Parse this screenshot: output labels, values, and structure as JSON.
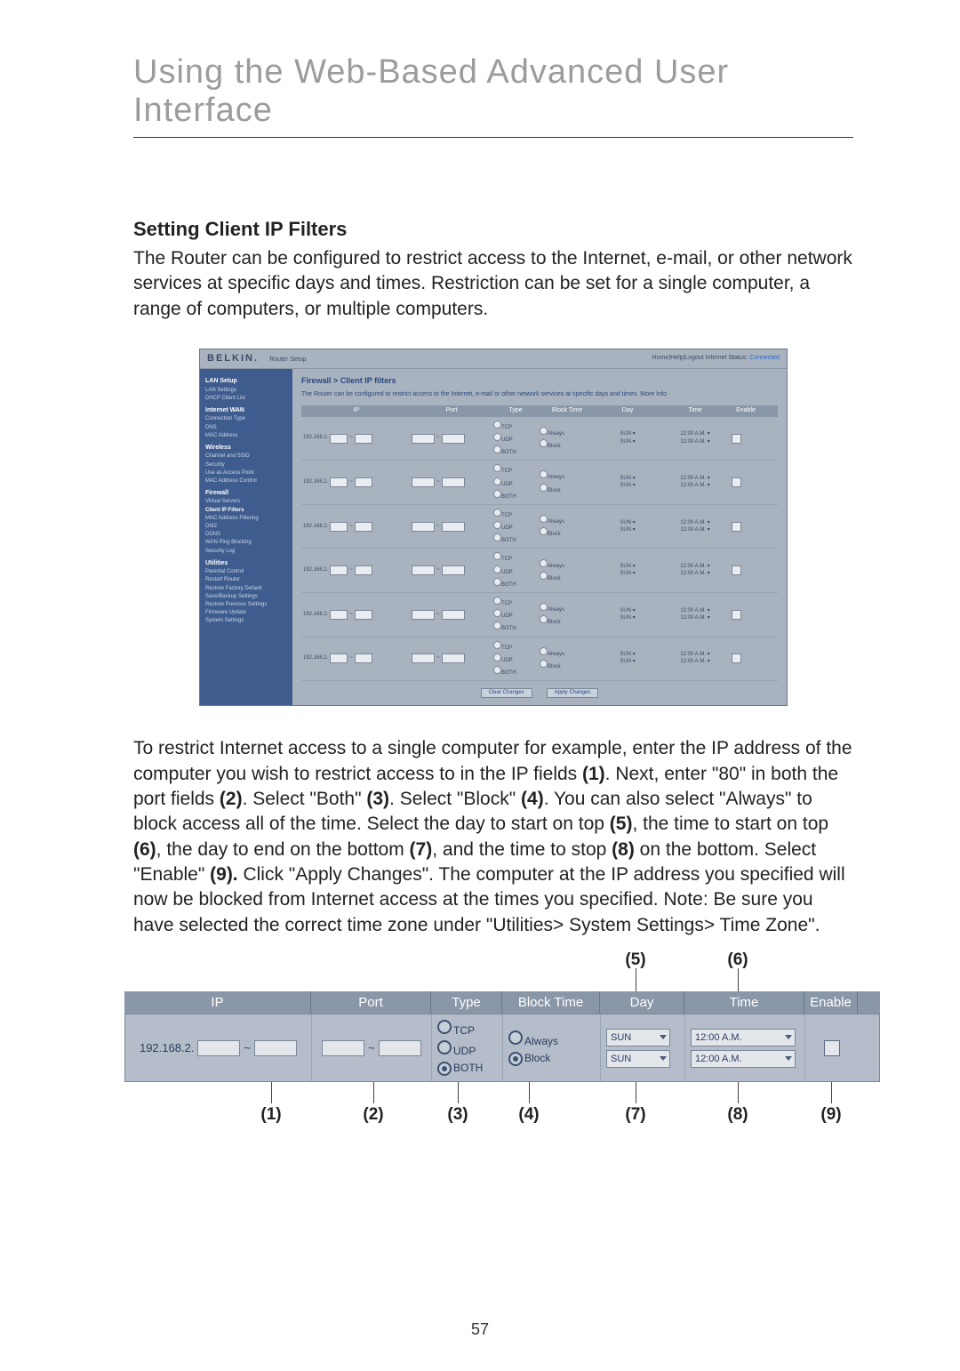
{
  "banner": "Using the Web-Based Advanced User Interface",
  "heading": "Setting Client IP Filters",
  "intro": "The Router can be configured to restrict access to the Internet, e-mail, or other network services at specific days and times. Restriction can be set for a single computer, a range of computers, or multiple computers.",
  "para2a": "To restrict Internet access to a single computer for example, enter the IP address of the computer you wish to restrict access to in the IP fields ",
  "b1": "(1)",
  "para2b": ". Next, enter \"80\" in both the port fields ",
  "b2": "(2)",
  "para2c": ". Select \"Both\" ",
  "b3": "(3)",
  "para2d": ". Select \"Block\" ",
  "b4": "(4)",
  "para2e": ". You can also select \"Always\" to block access all of the time. Select the day to start on top ",
  "b5": "(5)",
  "para2f": ", the time to start on top ",
  "b6": "(6)",
  "para2g": ", the day to end on the bottom ",
  "b7": "(7)",
  "para2h": ", and the time to stop ",
  "b8": "(8)",
  "para2i": " on the bottom. Select \"Enable\" ",
  "b9": "(9).",
  "para2j": " Click \"Apply Changes\". The computer at the IP address you specified will now be blocked from Internet access at the times you specified. Note: Be sure you have selected the correct time zone under \"Utilities> System Settings> Time Zone\".",
  "page_number": "57",
  "screenshot": {
    "brand": "BELKIN.",
    "router": "Router Setup",
    "status_left": "Home|Help|Logout  Internet Status:",
    "status_conn": "Connected",
    "section_title": "Firewall > Client IP filters",
    "description": "The Router can be configured to restrict access to the Internet, e-mail or other network services at specific days and times. More Info",
    "headers": {
      "ip": "IP",
      "port": "Port",
      "type": "Type",
      "block": "Block Time",
      "day": "Day",
      "time": "Time",
      "enable": "Enable"
    },
    "sidebar": [
      {
        "type": "head",
        "label": "LAN Setup"
      },
      {
        "type": "item",
        "label": "LAN Settings"
      },
      {
        "type": "item",
        "label": "DHCP Client List"
      },
      {
        "type": "head",
        "label": "Internet WAN"
      },
      {
        "type": "item",
        "label": "Connection Type"
      },
      {
        "type": "item",
        "label": "DNS"
      },
      {
        "type": "item",
        "label": "MAC Address"
      },
      {
        "type": "head",
        "label": "Wireless"
      },
      {
        "type": "item",
        "label": "Channel and SSID"
      },
      {
        "type": "item",
        "label": "Security"
      },
      {
        "type": "item",
        "label": "Use as Access Point"
      },
      {
        "type": "item",
        "label": "MAC Address Control"
      },
      {
        "type": "head",
        "label": "Firewall"
      },
      {
        "type": "item",
        "label": "Virtual Servers"
      },
      {
        "type": "sel",
        "label": "Client IP Filters"
      },
      {
        "type": "item",
        "label": "MAC Address Filtering"
      },
      {
        "type": "item",
        "label": "DMZ"
      },
      {
        "type": "item",
        "label": "DDNS"
      },
      {
        "type": "item",
        "label": "WAN Ping Blocking"
      },
      {
        "type": "item",
        "label": "Security Log"
      },
      {
        "type": "head",
        "label": "Utilities"
      },
      {
        "type": "item",
        "label": "Parental Control"
      },
      {
        "type": "item",
        "label": "Restart Router"
      },
      {
        "type": "item",
        "label": "Restore Factory Default"
      },
      {
        "type": "item",
        "label": "Save/Backup Settings"
      },
      {
        "type": "item",
        "label": "Restore Previous Settings"
      },
      {
        "type": "item",
        "label": "Firmware Update"
      },
      {
        "type": "item",
        "label": "System Settings"
      }
    ],
    "rule_ip_prefix": "192.168.2.",
    "type_labels": {
      "tcp": "TCP",
      "udp": "UDP",
      "both": "BOTH"
    },
    "block_labels": {
      "always": "Always",
      "block": "Block"
    },
    "day_val": "SUN",
    "time_val": "12:00 A.M.",
    "btn_clear": "Clear Changes",
    "btn_apply": "Apply Changes"
  },
  "filter_closeup": {
    "headers": {
      "ip": "IP",
      "port": "Port",
      "type": "Type",
      "block": "Block Time",
      "day": "Day",
      "time": "Time",
      "enable": "Enable"
    },
    "ip_prefix": "192.168.2.",
    "dash": "~",
    "type": {
      "tcp": "TCP",
      "udp": "UDP",
      "both": "BOTH"
    },
    "block": {
      "always": "Always",
      "block": "Block"
    },
    "day": "SUN",
    "time": "12:00 A.M."
  },
  "callouts": {
    "c1": "(1)",
    "c2": "(2)",
    "c3": "(3)",
    "c4": "(4)",
    "c5": "(5)",
    "c6": "(6)",
    "c7": "(7)",
    "c8": "(8)",
    "c9": "(9)"
  }
}
